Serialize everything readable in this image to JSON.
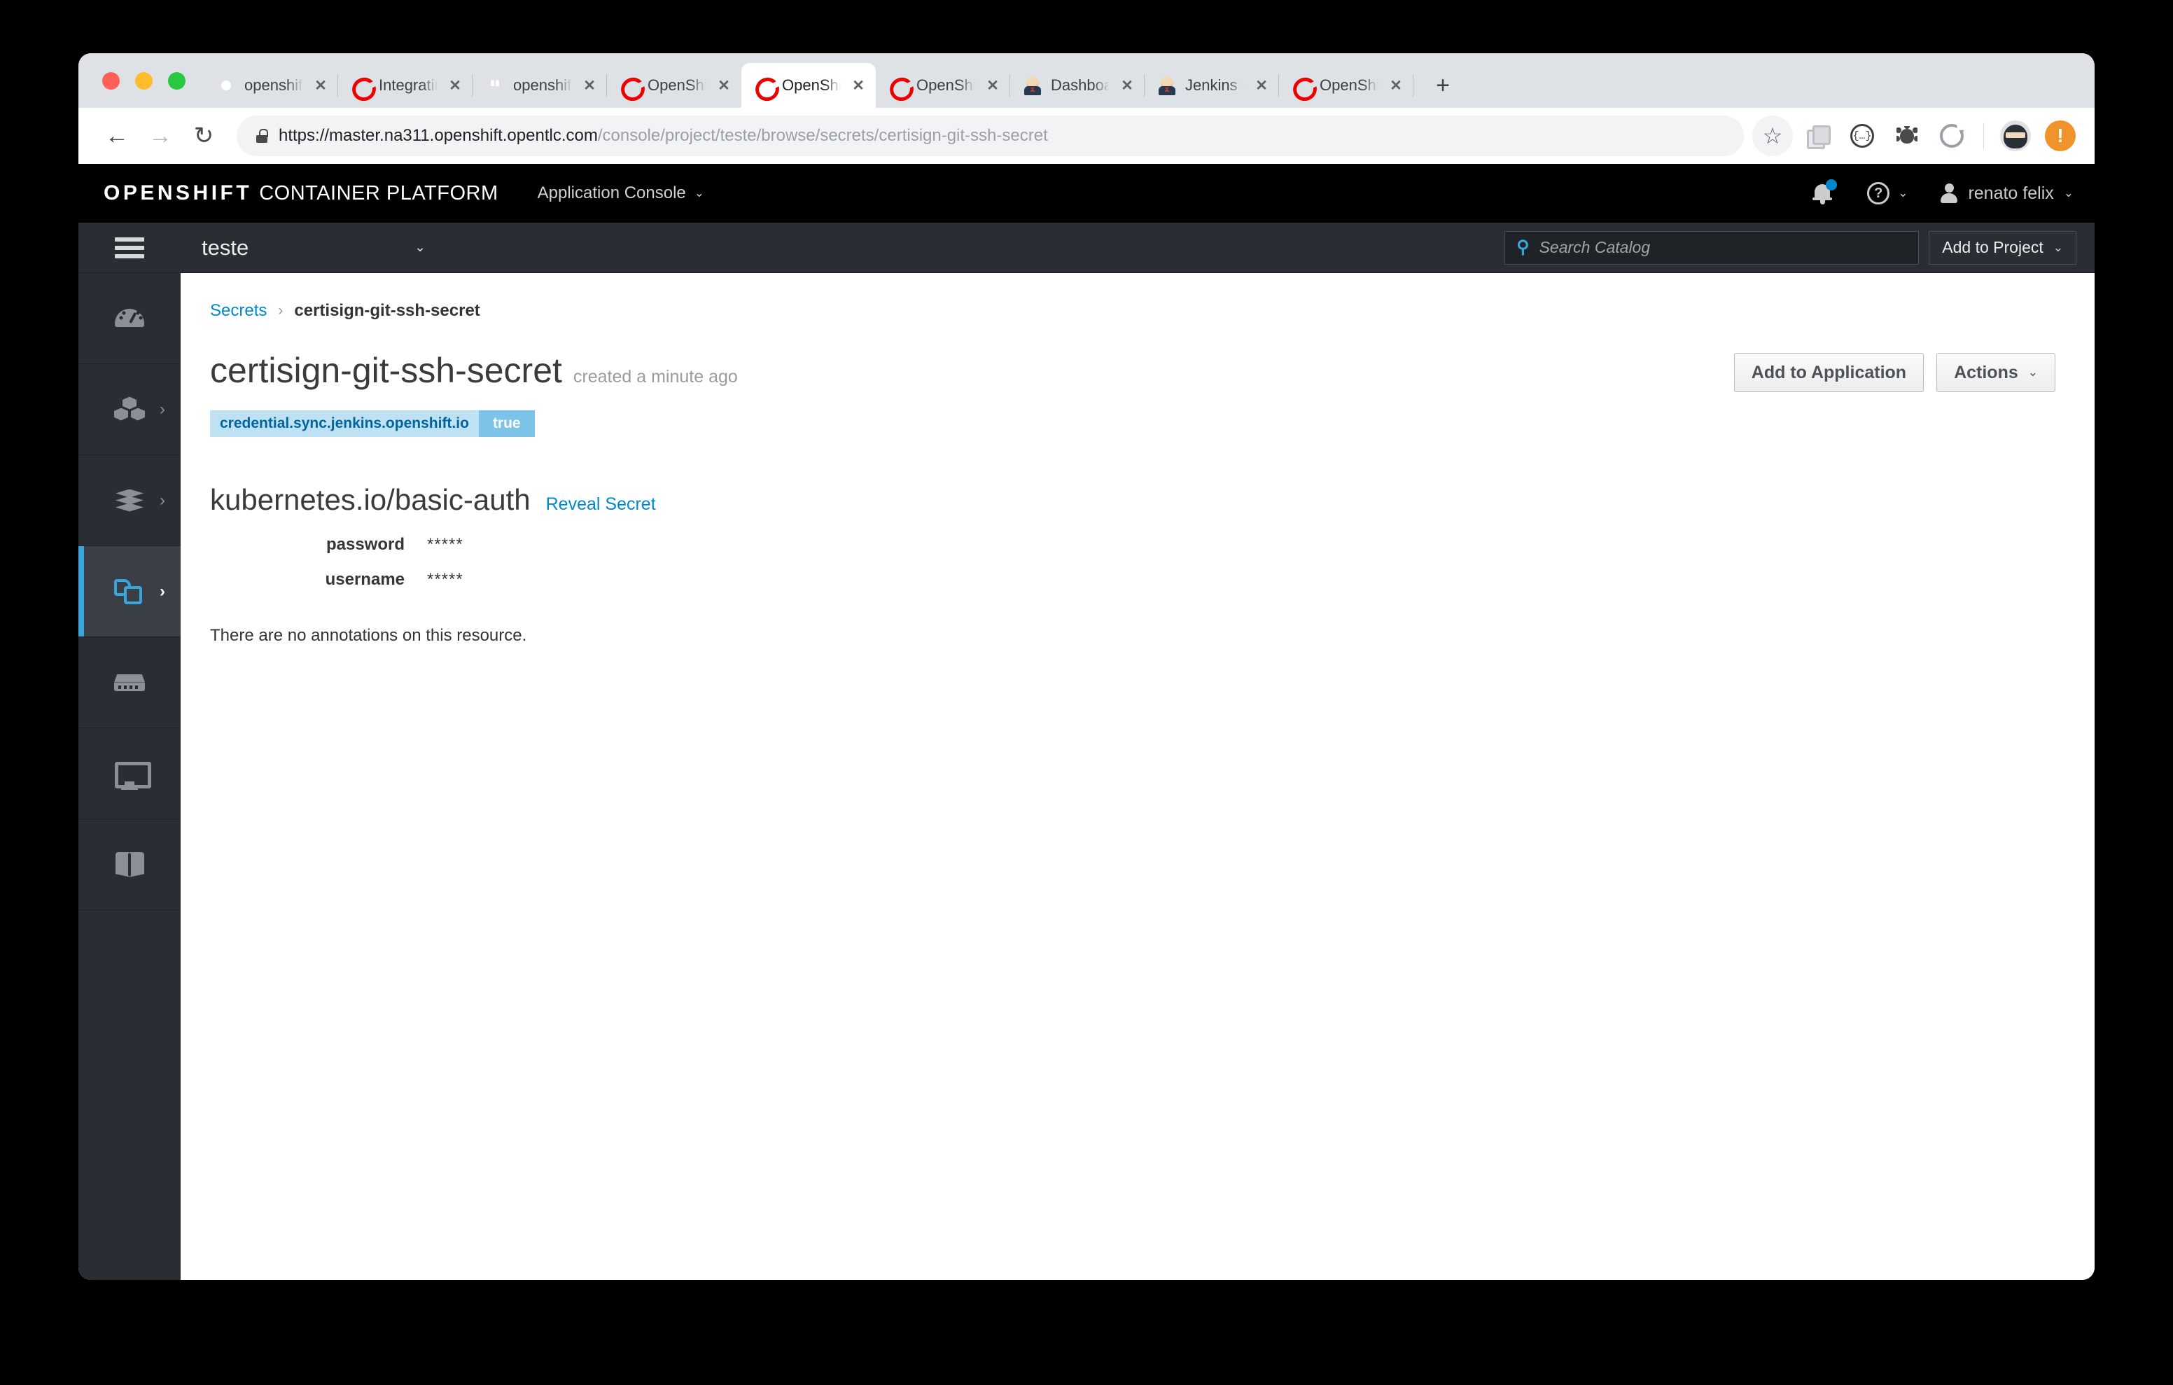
{
  "browser": {
    "traffic_lights": [
      "close",
      "minimize",
      "maximize"
    ],
    "tabs": [
      {
        "title": "openshift end",
        "favicon": "google-icon",
        "active": false
      },
      {
        "title": "Integrating Ex",
        "favicon": "openshift-icon",
        "active": false
      },
      {
        "title": "openshift/jenk",
        "favicon": "github-icon",
        "active": false
      },
      {
        "title": "OpenShift We",
        "favicon": "openshift-icon",
        "active": false
      },
      {
        "title": "OpenShift We",
        "favicon": "openshift-icon",
        "active": true
      },
      {
        "title": "OpenShift We",
        "favicon": "openshift-icon",
        "active": false
      },
      {
        "title": "Dashboard [J",
        "favicon": "jenkins-icon",
        "active": false
      },
      {
        "title": "Jenkins » Cre",
        "favicon": "jenkins-icon",
        "active": false
      },
      {
        "title": "OpenShift We",
        "favicon": "openshift-icon",
        "active": false
      }
    ],
    "new_tab_label": "+",
    "tab_close_label": "✕",
    "nav": {
      "back": "←",
      "forward": "→",
      "reload": "↻"
    },
    "url": {
      "host": "https://master.na311.openshift.opentlc.com",
      "path": "/console/project/teste/browse/secrets/certisign-git-ssh-secret"
    },
    "toolbar_icons": [
      "star-icon",
      "tabs-icon",
      "json-viewer-icon",
      "bug-icon",
      "reload-extension-icon",
      "ninja-avatar-icon",
      "alert-badge-icon"
    ],
    "json_icon_label": "{…}",
    "alert_icon_label": "!"
  },
  "masthead": {
    "brand_bold": "OPENSHIFT",
    "brand_light": "CONTAINER PLATFORM",
    "console_selector": "Application Console",
    "chevron": "⌄",
    "notifications_icon": "bell-icon",
    "help_label": "?",
    "user_name": "renato felix"
  },
  "projectbar": {
    "menu_icon": "hamburger-icon",
    "project_name": "teste",
    "project_chevron": "⌄",
    "search": {
      "icon": "search-icon",
      "placeholder": "Search Catalog",
      "value": ""
    },
    "add_to_project_label": "Add to Project",
    "add_to_project_chevron": "⌄"
  },
  "sidebar": {
    "items": [
      {
        "name": "overview",
        "icon": "gauge-icon",
        "has_arrow": false,
        "active": false
      },
      {
        "name": "applications",
        "icon": "cubes-icon",
        "has_arrow": true,
        "active": false
      },
      {
        "name": "builds",
        "icon": "layers-icon",
        "has_arrow": true,
        "active": false
      },
      {
        "name": "resources",
        "icon": "copies-icon",
        "has_arrow": true,
        "active": true
      },
      {
        "name": "storage",
        "icon": "disk-icon",
        "has_arrow": false,
        "active": false
      },
      {
        "name": "monitoring",
        "icon": "monitor-icon",
        "has_arrow": false,
        "active": false
      },
      {
        "name": "catalog",
        "icon": "book-icon",
        "has_arrow": false,
        "active": false
      }
    ],
    "arrow": "›"
  },
  "main": {
    "breadcrumb": {
      "parent": "Secrets",
      "separator": "›",
      "current": "certisign-git-ssh-secret"
    },
    "page_title": "certisign-git-ssh-secret",
    "created_text": "created a minute ago",
    "actions": {
      "add_to_application": "Add to Application",
      "actions_label": "Actions",
      "actions_chevron": "⌄"
    },
    "labels": [
      {
        "key": "credential.sync.jenkins.openshift.io",
        "value": "true"
      }
    ],
    "secret_type": "kubernetes.io/basic-auth",
    "reveal_link": "Reveal Secret",
    "secret_entries": [
      {
        "term": "password",
        "value": "*****"
      },
      {
        "term": "username",
        "value": "*****"
      }
    ],
    "annotations_empty": "There are no annotations on this resource."
  },
  "colors": {
    "accent_blue": "#0088ce",
    "sidebar_active_blue": "#39a5dc",
    "label_key_bg": "#bee1f4",
    "label_value_bg": "#7dc3e8",
    "masthead_bg": "#000000",
    "projectbar_bg": "#292e34"
  }
}
